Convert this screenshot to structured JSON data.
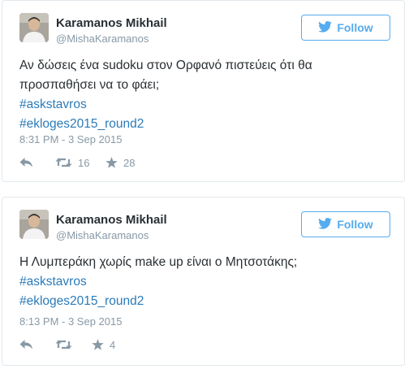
{
  "tweets": [
    {
      "author": {
        "name": "Karamanos Mikhail",
        "handle": "@MishaKaramanos"
      },
      "follow_label": "Follow",
      "text_lines": [
        "Αν δώσεις ένα sudoku στον Ορφανό πιστεύεις ότι θα",
        "προσπαθήσει να το φάει;"
      ],
      "hashtags": [
        "#askstavros",
        "#ekloges2015_round2"
      ],
      "timestamp": "8:31 PM - 3 Sep 2015",
      "retweets": "16",
      "favorites": "28"
    },
    {
      "author": {
        "name": "Karamanos Mikhail",
        "handle": "@MishaKaramanos"
      },
      "follow_label": "Follow",
      "text_lines": [
        "Η Λυμπεράκη χωρίς make up είναι ο Μητσοτάκης;"
      ],
      "hashtags": [
        "#askstavros",
        "#ekloges2015_round2"
      ],
      "timestamp": "8:13 PM - 3 Sep 2015",
      "retweets": "",
      "favorites": "4"
    }
  ],
  "colors": {
    "accent": "#55acee",
    "link": "#2b7bb9",
    "text": "#292f33",
    "muted": "#8899a6",
    "border": "#e1e8ed"
  },
  "icons": [
    "twitter-bird-icon",
    "reply-icon",
    "retweet-icon",
    "favorite-star-icon"
  ]
}
